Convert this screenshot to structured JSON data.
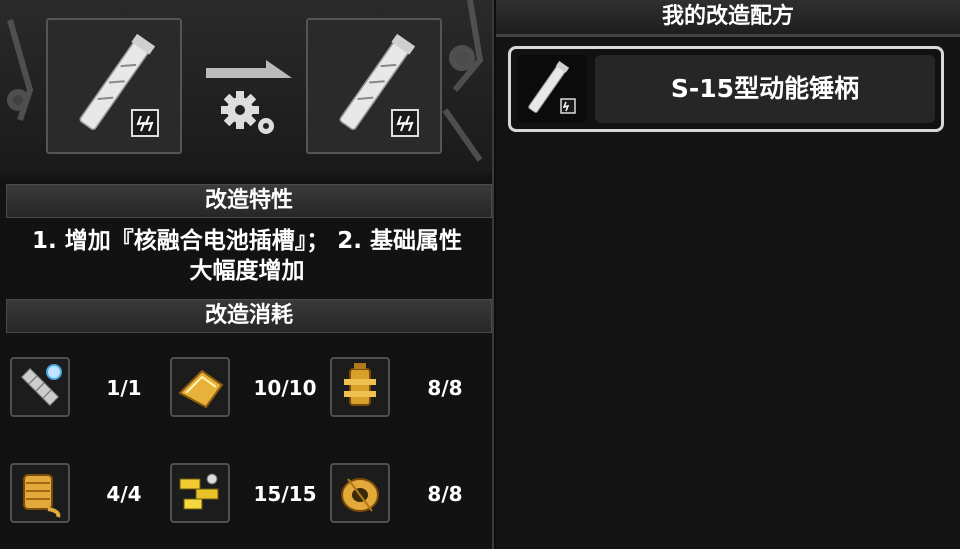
{
  "left_panel": {
    "traits_header": "改造特性",
    "traits_text_line1": "1. 增加『核融合电池插槽』； 2. 基础属性",
    "traits_text_line2": "大幅度增加",
    "cost_header": "改造消耗",
    "materials": [
      {
        "icon": "mechanical-arm-icon",
        "count": "1/1"
      },
      {
        "icon": "gold-plate-icon",
        "count": "10/10"
      },
      {
        "icon": "golden-core-icon",
        "count": "8/8"
      },
      {
        "icon": "wire-spool-icon",
        "count": "4/4"
      },
      {
        "icon": "gold-parts-icon",
        "count": "15/15"
      },
      {
        "icon": "coil-roll-icon",
        "count": "8/8"
      }
    ]
  },
  "right_panel": {
    "title": "我的改造配方",
    "recipes": [
      {
        "name": "S-15型动能锤柄",
        "icon": "hammer-handle-icon"
      }
    ]
  },
  "colors": {
    "gold": "#e0a52a",
    "frame": "#555555",
    "selected_border": "#d8d8d8"
  }
}
